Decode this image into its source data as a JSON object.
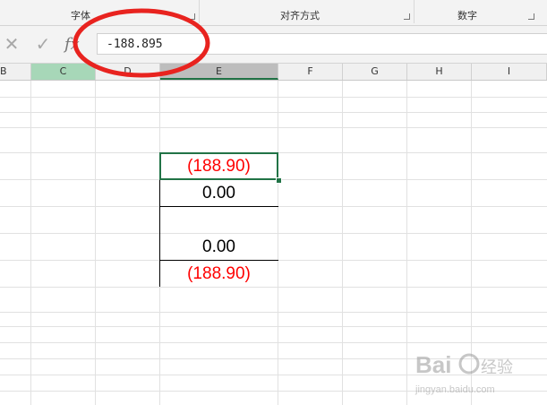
{
  "ribbon": {
    "groups": [
      {
        "label": "字体"
      },
      {
        "label": "对齐方式"
      },
      {
        "label": "数字"
      }
    ]
  },
  "formula_bar": {
    "cancel_icon": "close-icon",
    "enter_icon": "check-icon",
    "fx_label": "fx",
    "value": "-188.895"
  },
  "columns": [
    "B",
    "C",
    "D",
    "E",
    "F",
    "G",
    "H",
    "I"
  ],
  "cells": [
    {
      "text": "(188.90)",
      "negative": true
    },
    {
      "text": "0.00",
      "negative": false
    },
    {
      "text": "",
      "negative": false
    },
    {
      "text": "0.00",
      "negative": false
    },
    {
      "text": "(188.90)",
      "negative": true
    }
  ],
  "colors": {
    "accent": "#217346",
    "negative": "#ff0000",
    "annotation": "#e8231f"
  },
  "watermark": {
    "brand": "Baidu经验",
    "url": "jingyan.baidu.com"
  }
}
